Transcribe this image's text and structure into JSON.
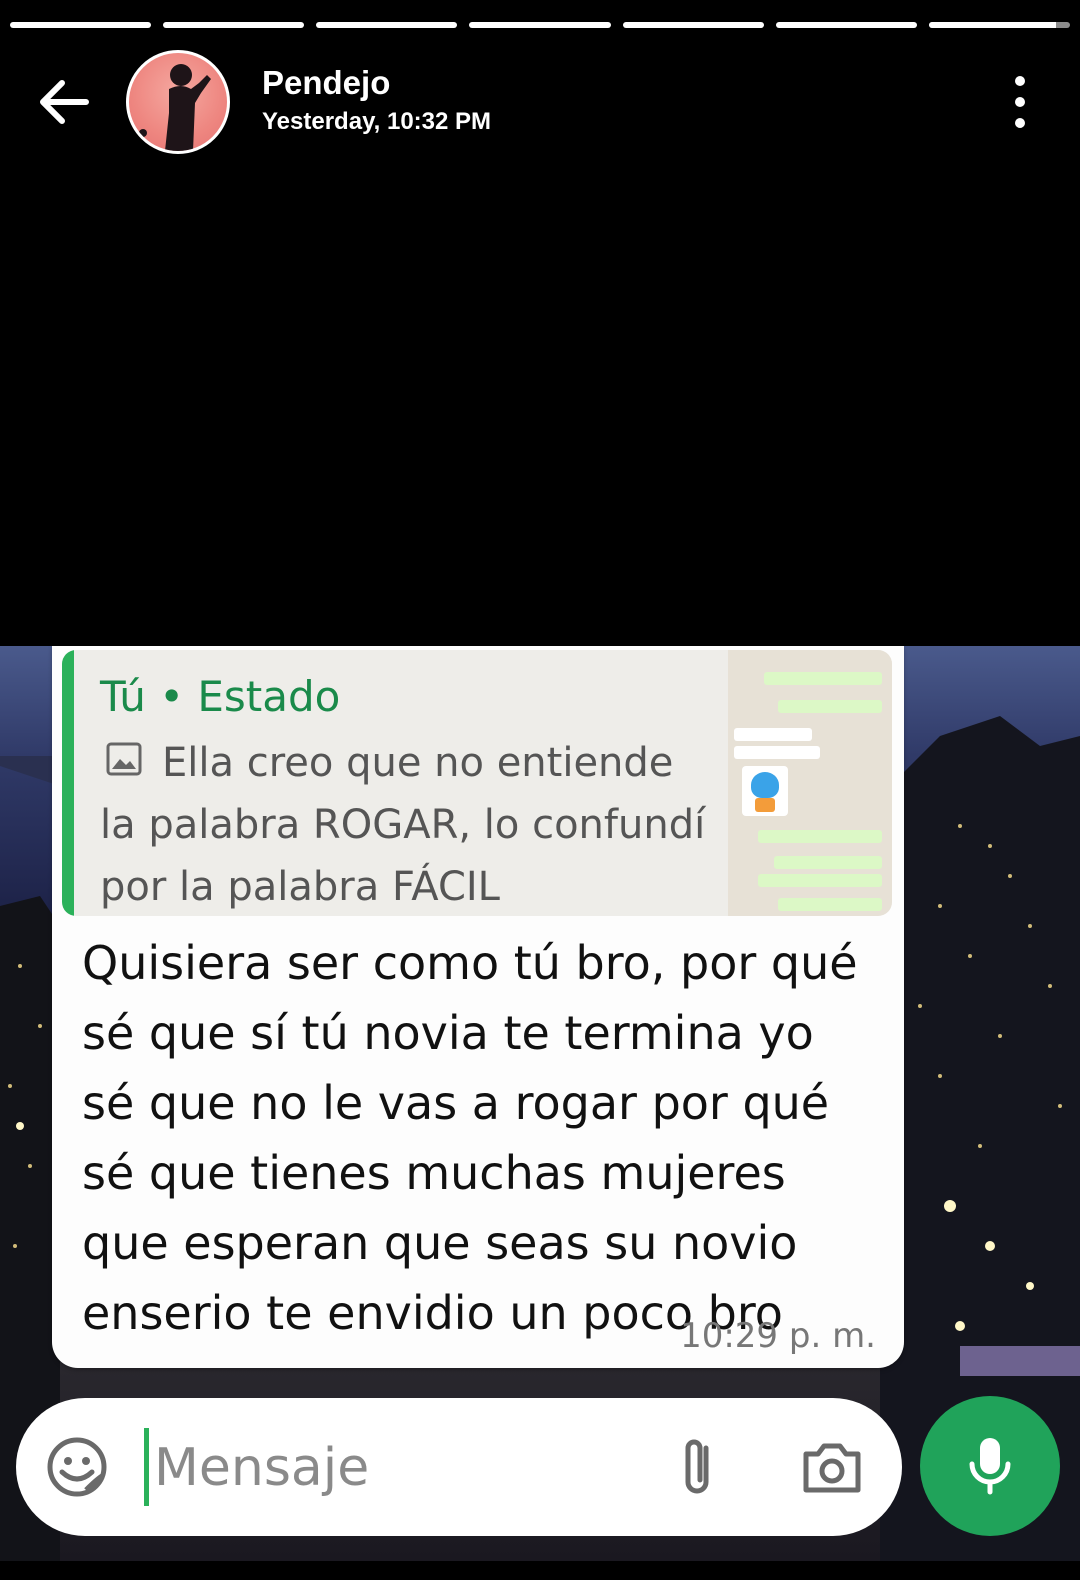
{
  "story": {
    "segments": [
      1,
      1,
      1,
      1,
      1,
      1,
      0.9
    ]
  },
  "header": {
    "contact_name": "Pendejo",
    "timestamp": "Yesterday, 10:32 PM",
    "back_icon": "arrow-left-icon",
    "menu_icon": "more-vertical-icon"
  },
  "chat": {
    "reply": {
      "author": "Tú • Estado",
      "media_icon": "image-icon",
      "text": "Ella creo que no entiende la palabra ROGAR, lo confundí por la palabra FÁCIL"
    },
    "message": {
      "text": "Quisiera ser como tú bro, por qué sé que sí tú novia te termina yo sé que no le vas a rogar por qué sé que tienes muchas mujeres que esperan que seas su novio enserio te envidio un poco bro",
      "time": "10:29 p. m."
    },
    "input": {
      "placeholder": "Mensaje",
      "emoji_icon": "emoji-icon",
      "attach_icon": "paperclip-icon",
      "camera_icon": "camera-icon",
      "mic_icon": "microphone-icon"
    }
  },
  "colors": {
    "accent": "#20a35a",
    "quote_bar": "#2bb15a",
    "avatar_bg": "#ee8680"
  }
}
